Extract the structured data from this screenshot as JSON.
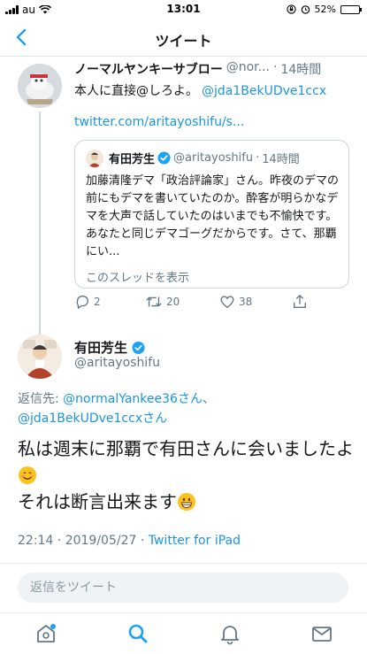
{
  "status_bar": {
    "carrier": "au",
    "time": "13:01",
    "battery": "52%",
    "battery_level": 0.52
  },
  "header": {
    "title": "ツイート"
  },
  "thread_tweet": {
    "name": "ノーマルヤンキーサブロー",
    "handle": "@nor...",
    "time": "14時間",
    "text": "本人に直接@しろよ。",
    "mention": "@jda1BekUDve1ccx",
    "url": "twitter.com/aritayoshifu/s..."
  },
  "quote": {
    "name": "有田芳生",
    "handle": "@aritayoshifu",
    "time": "14時間",
    "text": "加藤清隆デマ「政治評論家」さん。昨夜のデマの前にもデマを書いていたのか。酔客が明らかなデマを大声で話していたのはいまでも不愉快です。あなたと同じデマゴーグだからです。さて、那覇にい...",
    "show_thread": "このスレッドを表示"
  },
  "actions": {
    "replies": "2",
    "retweets": "20",
    "likes": "38"
  },
  "main_tweet": {
    "name": "有田芳生",
    "handle": "@aritayoshifu",
    "reply_to_prefix": "返信先: ",
    "reply_to_1": "@normalYankee36さん",
    "reply_to_sep": "、",
    "reply_to_2": "@jda1BekUDve1ccxさん",
    "text_line1": "私は週末に那覇で有田さんに会いました",
    "text_line2": "よ",
    "text_line3": "それは断言出来ます",
    "datetime": "22:14 · 2019/05/27 · ",
    "source": "Twitter for iPad"
  },
  "reply_bar": {
    "placeholder": "返信をツイート"
  },
  "colors": {
    "link": "#1b95e0",
    "verified": "#1da1f2",
    "muted": "#657786"
  },
  "tabs": [
    "home-icon",
    "search-icon",
    "notifications-icon",
    "messages-icon"
  ]
}
